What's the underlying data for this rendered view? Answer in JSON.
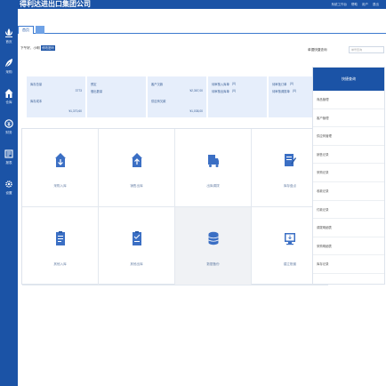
{
  "app": {
    "title": "得利达进出口集团公司",
    "top_links": [
      "系统工作台",
      "帮助",
      "用户",
      "退出"
    ]
  },
  "sidebar": {
    "items": [
      {
        "label": "首页",
        "icon": "lotus-icon"
      },
      {
        "label": "采购",
        "icon": "leaf-icon"
      },
      {
        "label": "仓库",
        "icon": "home-icon"
      },
      {
        "label": "财务",
        "icon": "coin-icon"
      },
      {
        "label": "报表",
        "icon": "report-icon"
      },
      {
        "label": "设置",
        "icon": "gear-icon"
      }
    ]
  },
  "tabs": {
    "home_label": "首页"
  },
  "greeting": {
    "text": "下午好，小明",
    "button_label": "修改密码"
  },
  "search": {
    "label": "单据快捷查询",
    "placeholder": "单号查询"
  },
  "stats": [
    {
      "lines": [
        [
          "库存总量",
          "3773"
        ],
        [
          "库存成本",
          "¥1,370,60"
        ]
      ]
    },
    {
      "lines": [
        [
          "预定",
          ""
        ],
        [
          "借出数量",
          ""
        ]
      ]
    },
    {
      "lines": [
        [
          "客户欠款",
          "¥2,367,00"
        ],
        [
          "供应商欠款",
          "¥1,038,00"
        ]
      ]
    },
    {
      "lines": [
        [
          "待审核入库单",
          "(0)"
        ],
        [
          "待审核出库单",
          "(0)"
        ]
      ]
    },
    {
      "lines": [
        [
          "待审批订单",
          "(0)"
        ],
        [
          "待审核调拨单",
          "(0)"
        ]
      ]
    }
  ],
  "modules": [
    {
      "label": "采购入库",
      "icon": "inbound-house-icon",
      "highlighted": false
    },
    {
      "label": "销售出库",
      "icon": "outbound-house-icon",
      "highlighted": false
    },
    {
      "label": "出库调拨",
      "icon": "truck-icon",
      "highlighted": false
    },
    {
      "label": "库存盘点",
      "icon": "edit-doc-icon",
      "highlighted": false
    },
    {
      "label": "其他入库",
      "icon": "clipboard-in-icon",
      "highlighted": false
    },
    {
      "label": "其他出库",
      "icon": "clipboard-out-icon",
      "highlighted": false
    },
    {
      "label": "数据备份",
      "icon": "database-icon",
      "highlighted": true
    },
    {
      "label": "建立账套",
      "icon": "monitor-icon",
      "highlighted": false
    }
  ],
  "quick": {
    "title": "快捷查询",
    "items": [
      "商品管理",
      "客户管理",
      "供应商管理",
      "销售记录",
      "采购记录",
      "收款记录",
      "付款记录",
      "调拨明细表",
      "采购明细表",
      "库存记录"
    ]
  },
  "colors": {
    "primary": "#1b53a6",
    "accent": "#3c79cf",
    "stat_bg": "#e6eefb",
    "icon": "#3b6fc4"
  }
}
